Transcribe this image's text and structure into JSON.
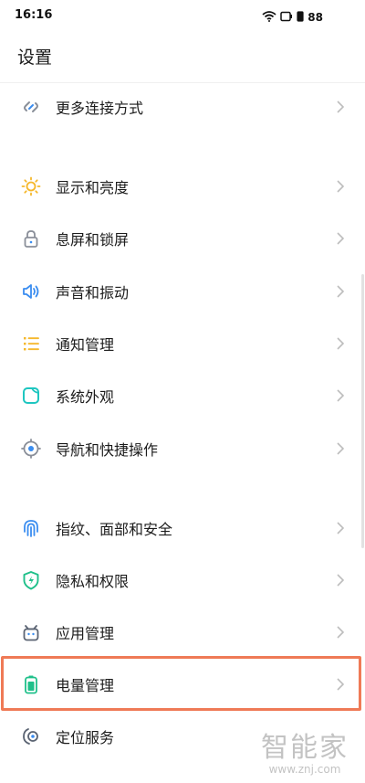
{
  "status_bar": {
    "time": "16:16",
    "battery": "88"
  },
  "header": {
    "title": "设置"
  },
  "settings": {
    "items": [
      {
        "label": "更多连接方式",
        "icon": "link-icon"
      },
      {
        "label": "显示和亮度",
        "icon": "sun-icon"
      },
      {
        "label": "息屏和锁屏",
        "icon": "lock-icon"
      },
      {
        "label": "声音和振动",
        "icon": "speaker-icon"
      },
      {
        "label": "通知管理",
        "icon": "list-icon"
      },
      {
        "label": "系统外观",
        "icon": "appearance-icon"
      },
      {
        "label": "导航和快捷操作",
        "icon": "navigation-icon"
      },
      {
        "label": "指纹、面部和安全",
        "icon": "fingerprint-icon"
      },
      {
        "label": "隐私和权限",
        "icon": "shield-icon"
      },
      {
        "label": "应用管理",
        "icon": "app-icon"
      },
      {
        "label": "电量管理",
        "icon": "battery-icon"
      },
      {
        "label": "定位服务",
        "icon": "location-icon"
      }
    ]
  },
  "watermark": {
    "text": "智能家",
    "url": "www.znj.com"
  },
  "colors": {
    "highlight": "#ef7a56",
    "sun": "#f5b72a",
    "blue": "#3a8df0",
    "teal": "#1ec6c0",
    "green": "#1fc08a",
    "gray_icon": "#8a8f99"
  }
}
